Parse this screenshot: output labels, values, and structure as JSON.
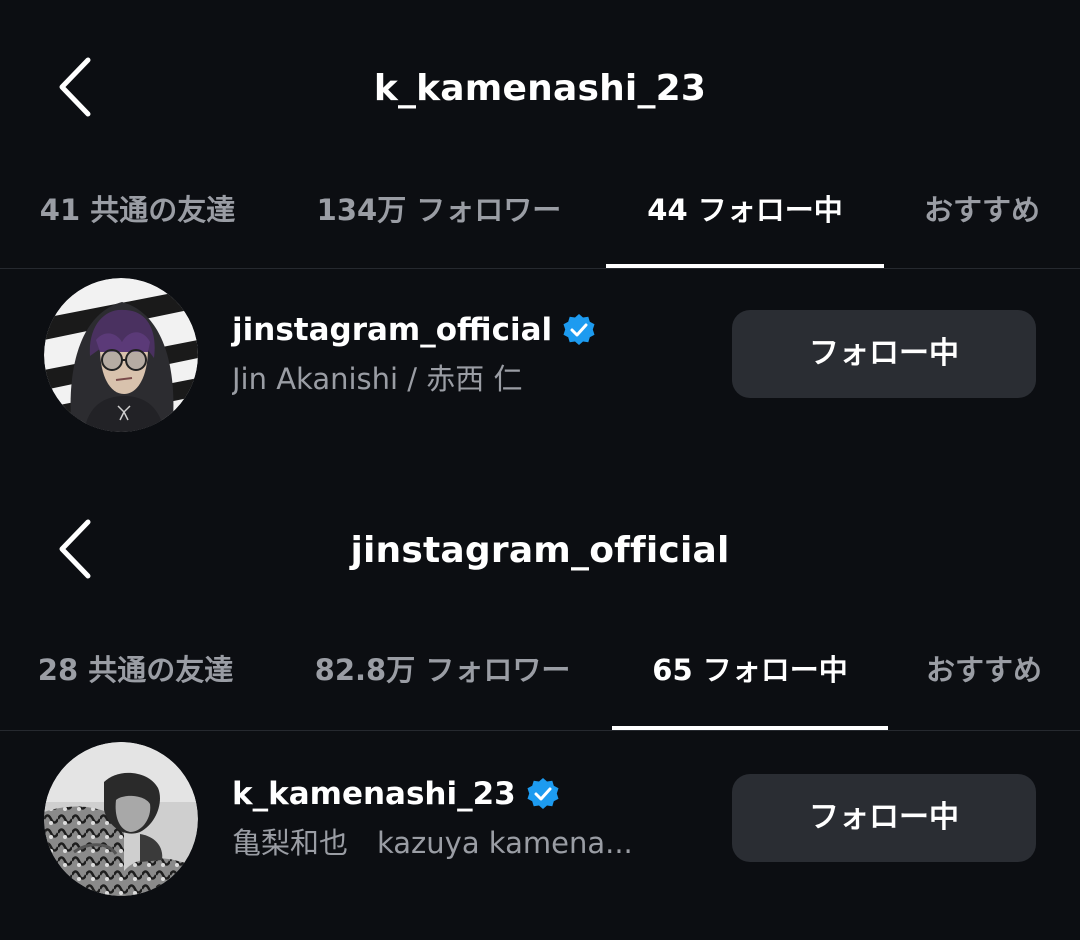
{
  "screens": [
    {
      "title": "k_kamenashi_23",
      "tabs": [
        {
          "label": "41 共通の友達",
          "active": false
        },
        {
          "label": "134万 フォロワー",
          "active": false
        },
        {
          "label": "44 フォロー中",
          "active": true
        },
        {
          "label": "おすすめ",
          "active": false
        }
      ],
      "user": {
        "username": "jinstagram_official",
        "verified": true,
        "full_name": "Jin Akanishi / 赤西 仁",
        "button_label": "フォロー中"
      }
    },
    {
      "title": "jinstagram_official",
      "tabs": [
        {
          "label": "28 共通の友達",
          "active": false
        },
        {
          "label": "82.8万 フォロワー",
          "active": false
        },
        {
          "label": "65 フォロー中",
          "active": true
        },
        {
          "label": "おすすめ",
          "active": false
        }
      ],
      "user": {
        "username": "k_kamenashi_23",
        "verified": true,
        "full_name": "亀梨和也　kazuya kamena...",
        "button_label": "フォロー中"
      }
    }
  ],
  "icons": {
    "back": "chevron-left-icon",
    "verified": "verified-badge-icon"
  },
  "colors": {
    "background": "#0c0e12",
    "verified_blue": "#1d9bf0",
    "button_bg": "#2a2d33",
    "secondary_text": "#9a9da4"
  }
}
